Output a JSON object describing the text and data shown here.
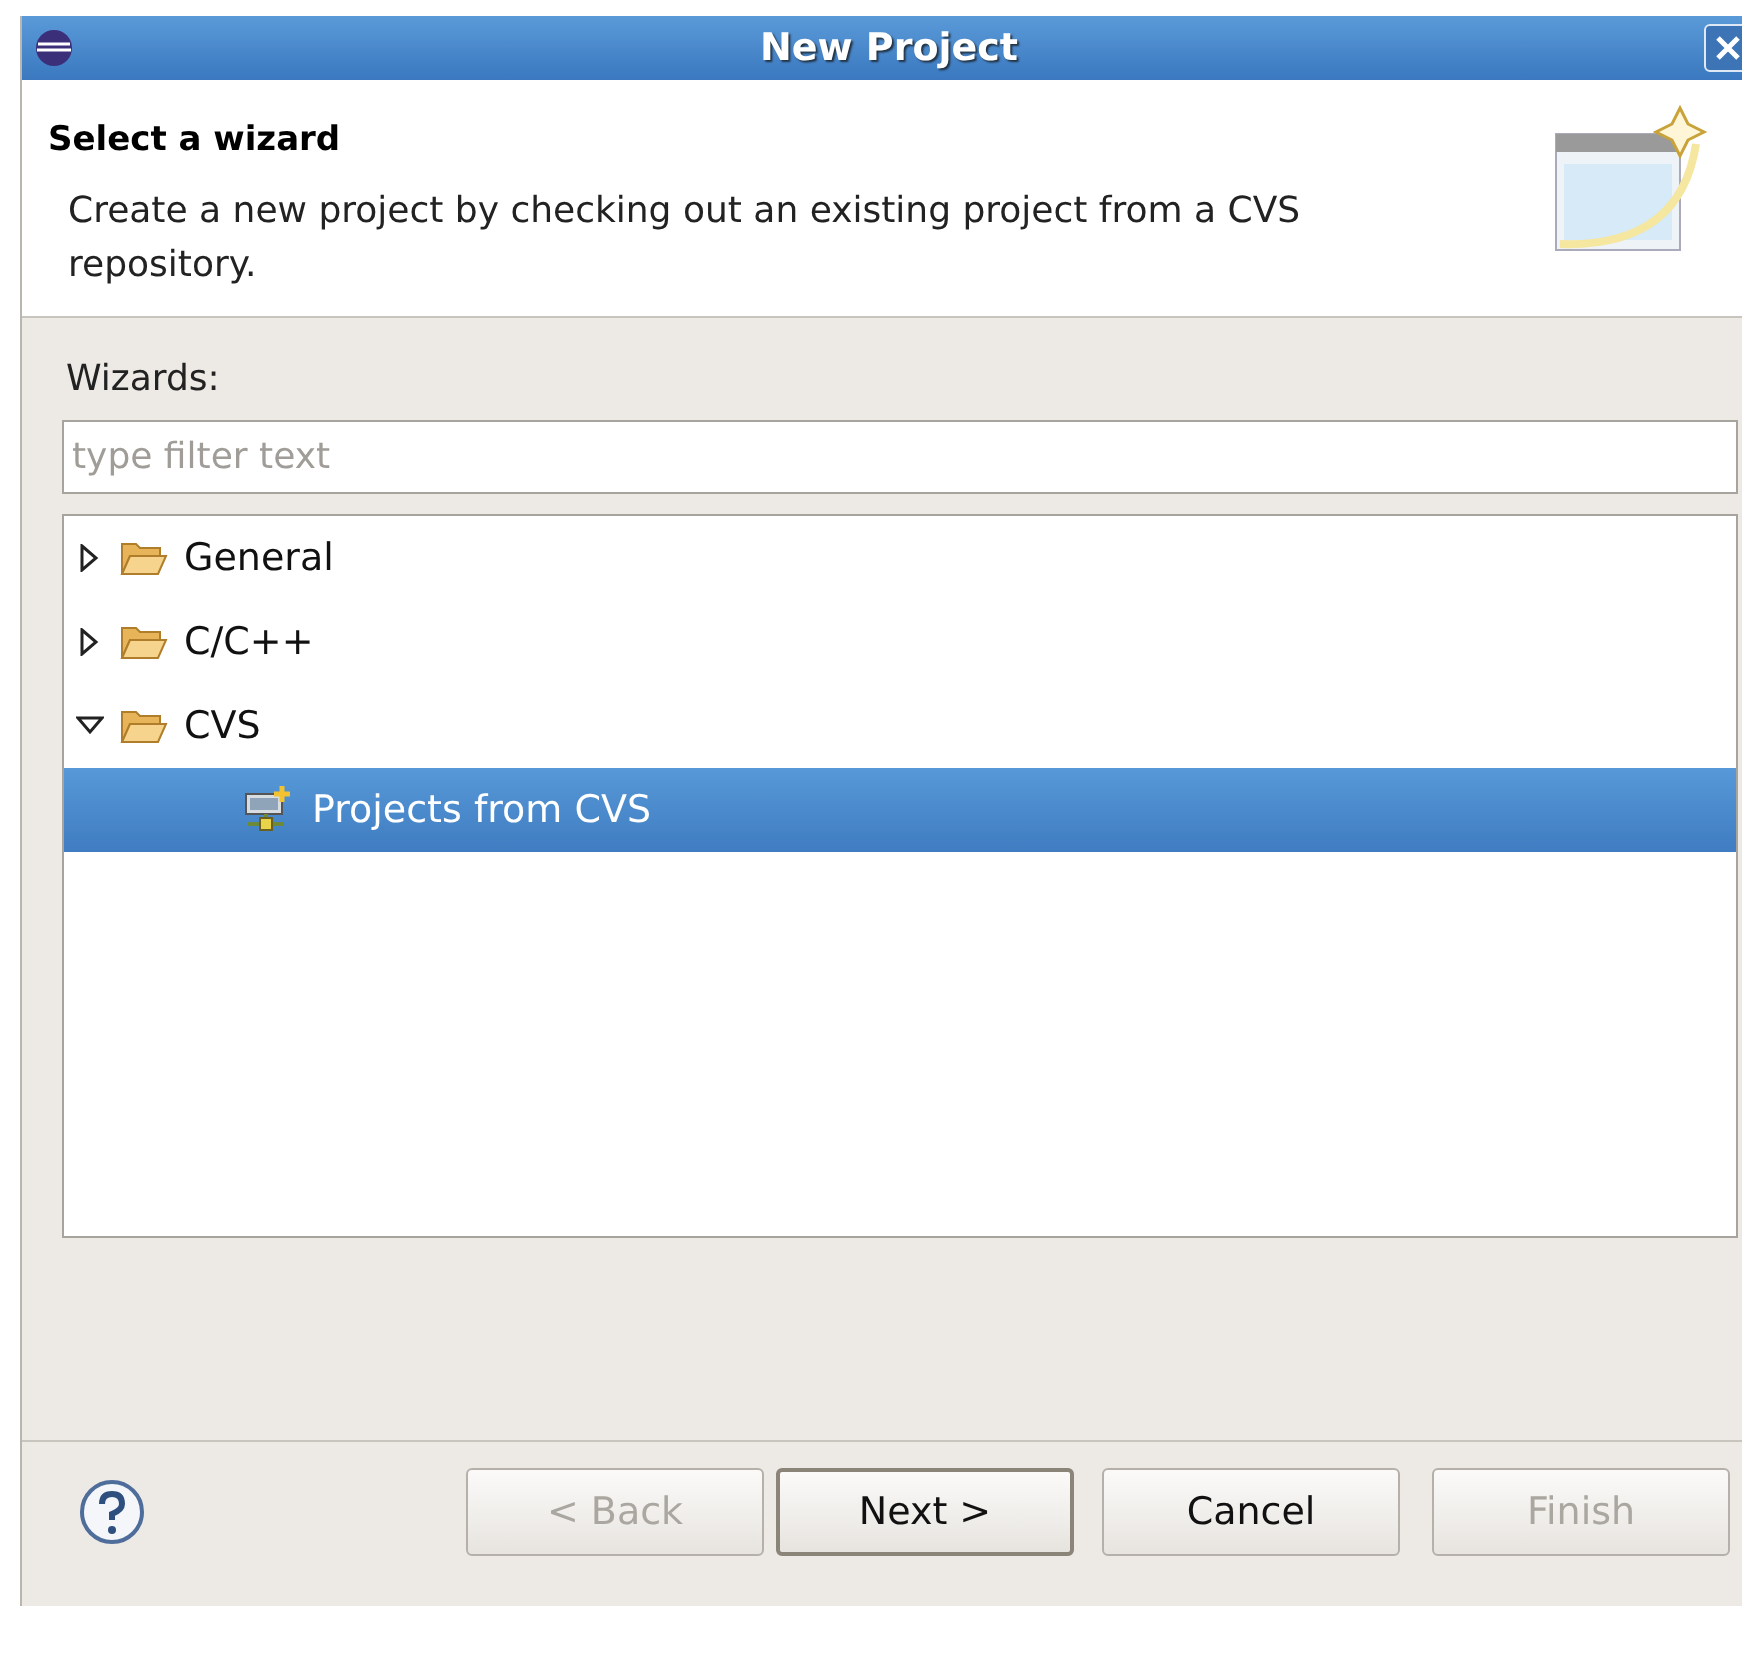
{
  "window": {
    "title": "New Project"
  },
  "header": {
    "title": "Select a wizard",
    "description": "Create a new project by checking out an existing project from a CVS repository."
  },
  "wizards_label": "Wizards:",
  "filter": {
    "placeholder": "type filter text"
  },
  "tree": [
    {
      "label": "General",
      "kind": "folder",
      "expanded": false,
      "selected": false
    },
    {
      "label": "C/C++",
      "kind": "folder",
      "expanded": false,
      "selected": false
    },
    {
      "label": "CVS",
      "kind": "folder",
      "expanded": true,
      "selected": false,
      "children": [
        {
          "label": "Projects from CVS",
          "kind": "cvs",
          "selected": true
        }
      ]
    }
  ],
  "buttons": [
    {
      "label": "< Back",
      "disabled": true,
      "default": false
    },
    {
      "label": "Next >",
      "disabled": false,
      "default": true
    },
    {
      "label": "Cancel",
      "disabled": false,
      "default": false
    },
    {
      "label": "Finish",
      "disabled": true,
      "default": false
    }
  ]
}
